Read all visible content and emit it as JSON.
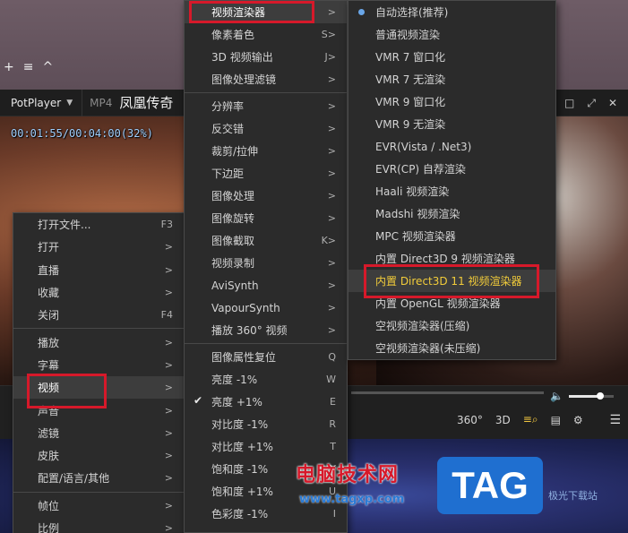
{
  "mini_toolbar": {
    "plus": "+",
    "list": "≡",
    "up": "^"
  },
  "player": {
    "logo": "PotPlayer",
    "format": "MP4",
    "title": "凤凰传奇",
    "osd_time": "00:01:55/00:04:00(32%)",
    "volume_fraction": 0.7,
    "controls": {
      "vr": "360°",
      "three_d": "3D"
    }
  },
  "main_menu": {
    "items": [
      {
        "label": "打开文件...",
        "key": "F3"
      },
      {
        "label": "打开",
        "key": ">"
      },
      {
        "label": "直播",
        "key": ">"
      },
      {
        "label": "收藏",
        "key": ">"
      },
      {
        "label": "关闭",
        "key": "F4"
      },
      {
        "label": "播放",
        "key": ">"
      },
      {
        "label": "字幕",
        "key": ">"
      },
      {
        "label": "视频",
        "key": ">"
      },
      {
        "label": "声音",
        "key": ">"
      },
      {
        "label": "滤镜",
        "key": ">"
      },
      {
        "label": "皮肤",
        "key": ">"
      },
      {
        "label": "配置/语言/其他",
        "key": ">"
      },
      {
        "label": "帧位",
        "key": ">"
      },
      {
        "label": "比例",
        "key": ">"
      }
    ]
  },
  "video_menu": {
    "items": [
      {
        "label": "视频渲染器",
        "key": ">"
      },
      {
        "label": "像素着色",
        "key": "S>"
      },
      {
        "label": "3D 视频输出",
        "key": "J>"
      },
      {
        "label": "图像处理滤镜",
        "key": ">"
      },
      {
        "label": "分辨率",
        "key": ">"
      },
      {
        "label": "反交错",
        "key": ">"
      },
      {
        "label": "裁剪/拉伸",
        "key": ">"
      },
      {
        "label": "下边距",
        "key": ">"
      },
      {
        "label": "图像处理",
        "key": ">"
      },
      {
        "label": "图像旋转",
        "key": ">"
      },
      {
        "label": "图像截取",
        "key": "K>"
      },
      {
        "label": "视频录制",
        "key": ">"
      },
      {
        "label": "AviSynth",
        "key": ">"
      },
      {
        "label": "VapourSynth",
        "key": ">"
      },
      {
        "label": "播放 360° 视频",
        "key": ">"
      },
      {
        "label": "图像属性复位",
        "key": "Q"
      },
      {
        "label": "亮度 -1%",
        "key": "W"
      },
      {
        "label": "亮度 +1%",
        "key": "E"
      },
      {
        "label": "对比度 -1%",
        "key": "R"
      },
      {
        "label": "对比度 +1%",
        "key": "T"
      },
      {
        "label": "饱和度 -1%",
        "key": "Y"
      },
      {
        "label": "饱和度 +1%",
        "key": "U"
      },
      {
        "label": "色彩度 -1%",
        "key": "I"
      }
    ]
  },
  "renderer_menu": {
    "items": [
      {
        "label": "自动选择(推荐)"
      },
      {
        "label": "普通视频渲染"
      },
      {
        "label": "VMR 7 窗口化"
      },
      {
        "label": "VMR 7 无渲染"
      },
      {
        "label": "VMR 9 窗口化"
      },
      {
        "label": "VMR 9 无渲染"
      },
      {
        "label": "EVR(Vista / .Net3)"
      },
      {
        "label": "EVR(CP) 自荐渲染"
      },
      {
        "label": "Haali 视频渲染"
      },
      {
        "label": "Madshi 视频渲染"
      },
      {
        "label": "MPC 视频渲染器"
      },
      {
        "label": "内置 Direct3D 9 视频渲染器"
      },
      {
        "label": "内置 Direct3D 11 视频渲染器"
      },
      {
        "label": "内置 OpenGL 视频渲染器"
      },
      {
        "label": "空视频渲染器(压缩)"
      },
      {
        "label": "空视频渲染器(未压缩)"
      }
    ]
  },
  "watermark": {
    "cn": "电脑技术网",
    "url": "www.tagxp.com",
    "tag": "TAG",
    "side": "极光下载站"
  },
  "colors": {
    "highlight_box": "#d6192a",
    "selected_text": "#f2cc3a",
    "radio": "#6aa6e8"
  }
}
